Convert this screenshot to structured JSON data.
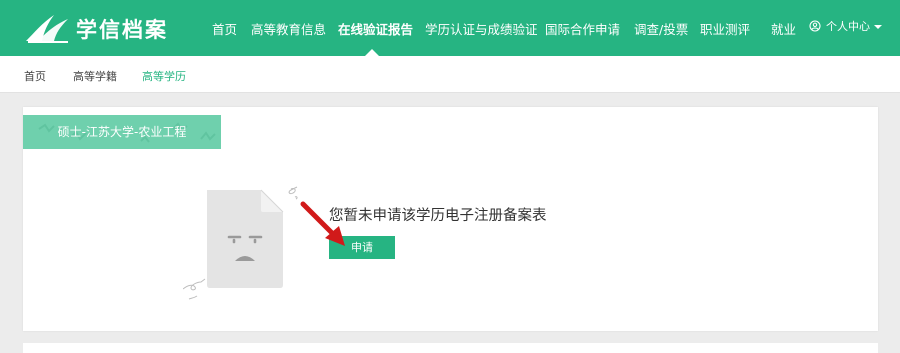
{
  "brand": {
    "name": "学信档案",
    "color": "#26b482"
  },
  "nav": {
    "items": [
      {
        "label": "首页",
        "active": false
      },
      {
        "label": "高等教育信息",
        "active": false
      },
      {
        "label": "在线验证报告",
        "active": true
      },
      {
        "label": "学历认证与成绩验证",
        "active": false
      },
      {
        "label": "国际合作申请",
        "active": false
      },
      {
        "label": "调查/投票",
        "active": false
      },
      {
        "label": "职业测评",
        "active": false
      },
      {
        "label": "就业",
        "active": false
      }
    ],
    "user_menu": {
      "label": "个人中心",
      "icon": "user-circle-icon"
    }
  },
  "breadcrumb": [
    "首页",
    "高等学籍",
    "高等学历"
  ],
  "record": {
    "tab_label": "硕士-江苏大学-农业工程",
    "empty_message": "您暂未申请该学历电子注册备案表",
    "apply_label": "申请",
    "illustration_icon": "sad-document-icon",
    "annotation_icon": "red-arrow-icon"
  }
}
